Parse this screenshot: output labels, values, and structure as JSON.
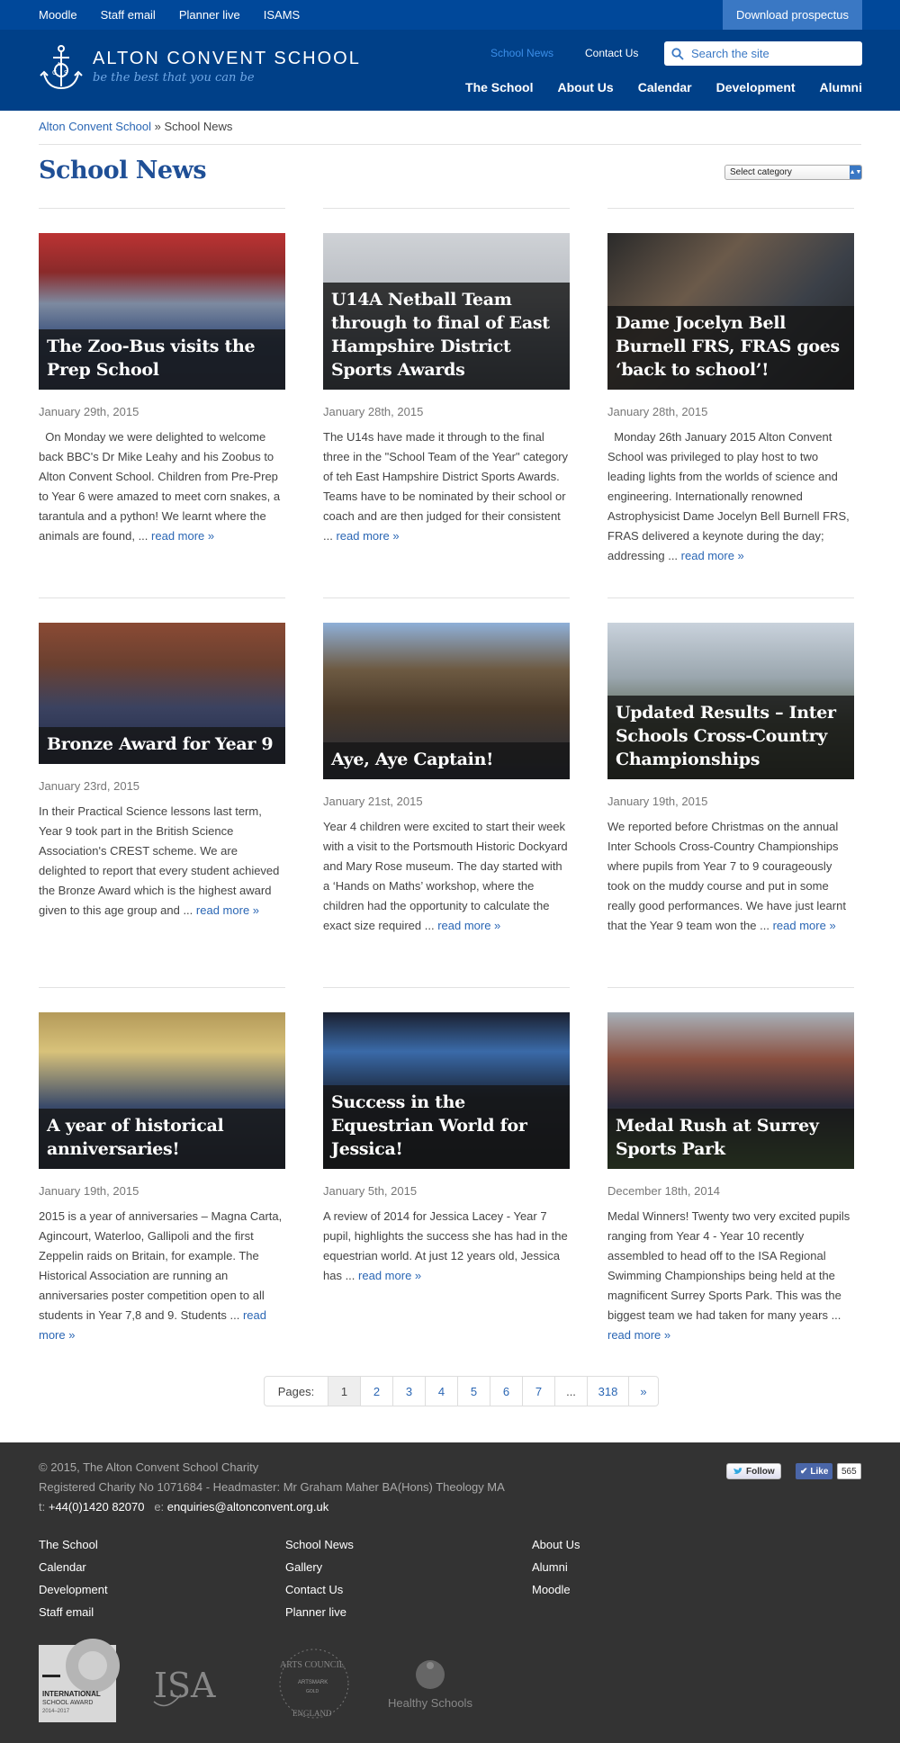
{
  "topbar": {
    "links": [
      "Moodle",
      "Staff email",
      "Planner live",
      "ISAMS"
    ],
    "prospectus": "Download prospectus"
  },
  "header": {
    "school_name": "ALTON CONVENT SCHOOL",
    "tagline": "be the best that you can be",
    "subnav_news": "School News",
    "subnav_contact": "Contact Us",
    "search_placeholder": "Search the site",
    "nav": [
      "The School",
      "About Us",
      "Calendar",
      "Development",
      "Alumni"
    ]
  },
  "breadcrumb": {
    "home": "Alton Convent School",
    "separator": "»",
    "current": "School News"
  },
  "page": {
    "title": "School News",
    "category_select": "Select category"
  },
  "posts": [
    {
      "title": "The Zoo-Bus visits the Prep School",
      "date": "January 29th, 2015",
      "excerpt": "On Monday we were delighted to welcome back BBC's Dr Mike Leahy and his Zoobus to Alton Convent School. Children from Pre-Prep to Year 6  were amazed to meet corn snakes, a tarantula and a python!  We learnt where the animals are found, ...",
      "more": "read more »"
    },
    {
      "title": "U14A Netball Team through to final of East Hampshire District Sports Awards",
      "date": "January 28th, 2015",
      "excerpt": "The U14s have made it through to the final three in the \"School Team of the Year\" category of teh East Hampshire District Sports Awards. Teams have to be nominated by their school or coach and are then judged for their consistent ...",
      "more": "read more »"
    },
    {
      "title": "Dame Jocelyn Bell Burnell FRS, FRAS goes ‘back to school’!",
      "date": "January 28th, 2015",
      "excerpt": "Monday 26th January 2015 Alton Convent School was privileged to play host to two leading lights from the worlds of science and engineering. Internationally renowned Astrophysicist Dame Jocelyn Bell Burnell FRS, FRAS delivered a keynote during the day; addressing ...",
      "more": "read more »"
    },
    {
      "title": "Bronze Award for Year 9",
      "date": "January 23rd, 2015",
      "excerpt": "In their Practical Science lessons last term, Year 9 took part in the British Science Association's CREST scheme. We are delighted to report that every student achieved the Bronze Award which is the highest award given to this age group and ...",
      "more": "read more »"
    },
    {
      "title": "Aye, Aye Captain!",
      "date": "January 21st, 2015",
      "excerpt": "Year 4 children were excited to start their week with a visit to the Portsmouth Historic Dockyard and Mary Rose museum. The day started with a ‘Hands on Maths’ workshop, where the children had the opportunity to calculate the exact size required ...",
      "more": "read more »"
    },
    {
      "title": "Updated Results – Inter Schools Cross-Country Championships",
      "date": "January 19th, 2015",
      "excerpt": "We reported before Christmas on the annual Inter Schools Cross-Country Championships where pupils from Year 7 to 9 courageously took on the muddy course and put in some really good performances. We have just learnt that the Year 9 team won the ...",
      "more": "read more »"
    },
    {
      "title": "A year of historical anniversaries!",
      "date": "January 19th, 2015",
      "excerpt": "2015 is a year of anniversaries – Magna Carta, Agincourt, Waterloo, Gallipoli and the first Zeppelin raids on Britain, for example. The Historical Association are running an anniversaries poster competition open to all students in Year 7,8 and 9. Students ...",
      "more": "read more »"
    },
    {
      "title": "Success in the Equestrian World for Jessica!",
      "date": "January 5th, 2015",
      "excerpt": "A review of 2014 for Jessica Lacey - Year 7 pupil, highlights the success she has had in the equestrian world. At just 12 years old, Jessica has ...",
      "more": "read more »"
    },
    {
      "title": "Medal Rush at Surrey Sports Park",
      "date": "December 18th, 2014",
      "excerpt": "Medal Winners! Twenty two very excited pupils ranging from Year 4 - Year 10 recently assembled to head off to the ISA Regional Swimming Championships being held at the magnificent Surrey Sports Park. This was the biggest team we had taken for many years ...",
      "more": "read more »"
    }
  ],
  "pagination": {
    "label": "Pages:",
    "pages": [
      "1",
      "2",
      "3",
      "4",
      "5",
      "6",
      "7"
    ],
    "dots": "...",
    "last": "318",
    "next": "»"
  },
  "footer": {
    "copyright": "© 2015, The Alton Convent School Charity",
    "registered": "Registered Charity No 1071684 - Headmaster: Mr Graham Maher BA(Hons) Theology MA",
    "tel_label": "t:",
    "tel": "+44(0)1420 82070",
    "email_label": "e:",
    "email": "enquiries@altonconvent.org.uk",
    "follow": "Follow",
    "like": "Like",
    "like_count": "565",
    "links_col1": [
      "The School",
      "Calendar",
      "Development",
      "Staff email"
    ],
    "links_col2": [
      "School News",
      "Gallery",
      "Contact Us",
      "Planner live"
    ],
    "links_col3": [
      "About Us",
      "Alumni",
      "Moodle"
    ],
    "badges": {
      "isa_text": "ISA",
      "arts_top": "ARTS COUNCIL",
      "arts_mid": "ARTSMARK",
      "arts_gold": "GOLD",
      "arts_bottom": "ENGLAND",
      "healthy": "Healthy Schools",
      "intl_line1": "INTERNATIONAL",
      "intl_line2": "SCHOOL AWARD",
      "intl_years": "2014–2017"
    }
  },
  "colors": {
    "brand_blue": "#004088",
    "topbar_blue": "#00489a",
    "link_blue": "#2a66b4",
    "footer_bg": "#333333"
  }
}
